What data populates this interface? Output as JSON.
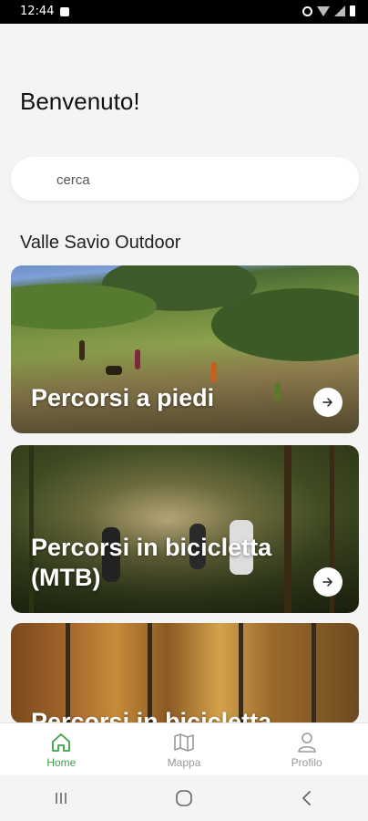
{
  "status_bar": {
    "time": "12:44"
  },
  "header": {
    "greeting": "Benvenuto!"
  },
  "search": {
    "placeholder": "cerca"
  },
  "section": {
    "title": "Valle Savio Outdoor"
  },
  "cards": [
    {
      "label": "Percorsi a piedi",
      "icon": "arrow-right-icon"
    },
    {
      "label": "Percorsi in bicicletta (MTB)",
      "icon": "arrow-right-icon"
    },
    {
      "label": "Percorsi in bicicletta"
    }
  ],
  "bottom_nav": {
    "items": [
      {
        "label": "Home",
        "icon": "home-icon",
        "active": true
      },
      {
        "label": "Mappa",
        "icon": "map-icon",
        "active": false
      },
      {
        "label": "Profilo",
        "icon": "user-icon",
        "active": false
      }
    ]
  },
  "colors": {
    "accent": "#3aa244",
    "inactive": "#999999"
  }
}
